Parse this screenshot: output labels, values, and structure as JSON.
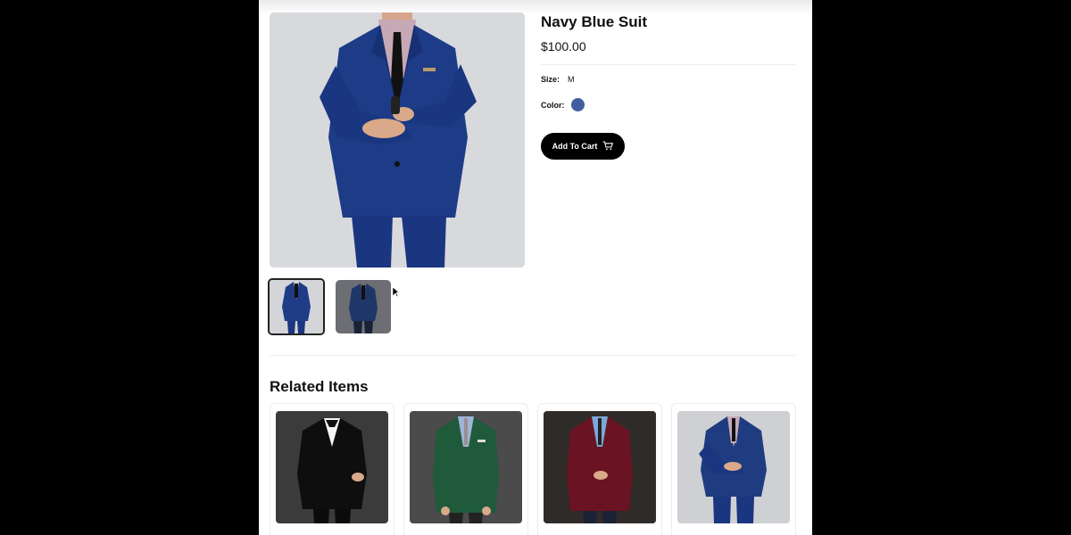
{
  "product": {
    "title": "Navy Blue Suit",
    "price": "$100.00",
    "size_label": "Size:",
    "size_value": "M",
    "color_label": "Color:",
    "color_swatch": "#3f5f9f",
    "add_to_cart_label": "Add To Cart",
    "cart_icon": "cart-icon"
  },
  "gallery": {
    "main_image": "navy-suit-photo",
    "thumbnails": [
      {
        "name": "navy-suit-front",
        "selected": true
      },
      {
        "name": "navy-suit-dark",
        "selected": false
      }
    ]
  },
  "related": {
    "title": "Related Items",
    "items": [
      {
        "image": "black-tuxedo",
        "suit_color": "#111111",
        "bg": "#3b3b3b"
      },
      {
        "image": "green-suit",
        "suit_color": "#1f5a3b",
        "bg": "#4b4b4b"
      },
      {
        "image": "burgundy-blazer",
        "suit_color": "#6a1322",
        "bg": "#2e2b29"
      },
      {
        "image": "navy-suit",
        "suit_color": "#1e3c7f",
        "bg": "#cfd0d4"
      }
    ]
  }
}
